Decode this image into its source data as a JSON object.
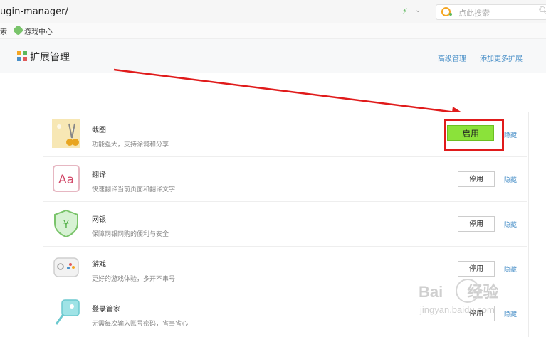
{
  "browser": {
    "url": "ugin-manager/",
    "search_placeholder": "点此搜索"
  },
  "bookmarks": {
    "left_fragment": "索",
    "games_label": "游戏中心"
  },
  "header": {
    "title": "扩展管理",
    "advanced_link": "高级管理",
    "add_more_link": "添加更多扩展"
  },
  "extensions": [
    {
      "name": "截图",
      "desc": "功能强大，支持涂鸦和分享",
      "button": "启用",
      "hide": "隐藏",
      "state": "disabled"
    },
    {
      "name": "翻译",
      "desc": "快速翻译当前页面和翻译文字",
      "button": "停用",
      "hide": "隐藏",
      "state": "enabled"
    },
    {
      "name": "网银",
      "desc": "保障网银网购的便利与安全",
      "button": "停用",
      "hide": "隐藏",
      "state": "enabled"
    },
    {
      "name": "游戏",
      "desc": "更好的游戏体验，多开不串号",
      "button": "停用",
      "hide": "隐藏",
      "state": "enabled"
    },
    {
      "name": "登录管家",
      "desc": "无需每次输入账号密码，省事省心",
      "button": "停用",
      "hide": "隐藏",
      "state": "enabled"
    }
  ],
  "watermark": {
    "brand": "Bai",
    "brand_cn": "经验",
    "site": "jingyan.baidu.com"
  },
  "colors": {
    "enable_button": "#8be23a",
    "link": "#4a90c8",
    "annotation_red": "#e01b1b"
  }
}
